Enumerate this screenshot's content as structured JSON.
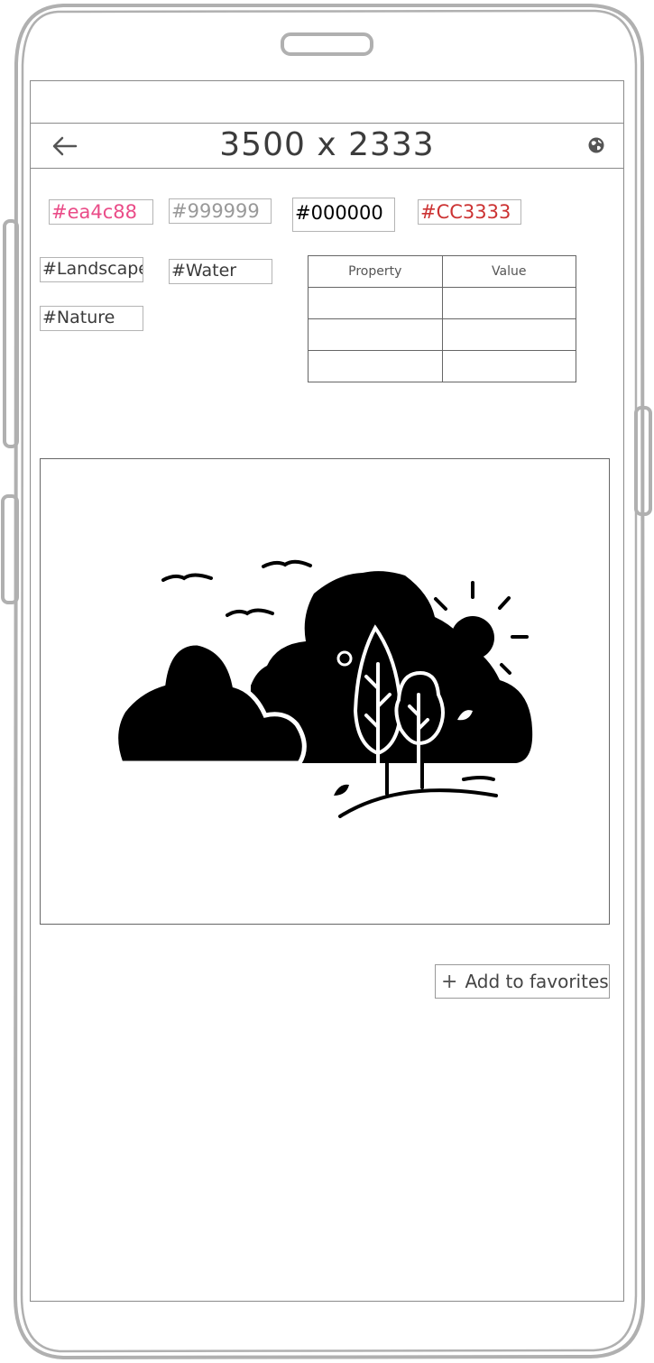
{
  "header": {
    "title": "3500 x 2333",
    "back_icon": "arrow-left-icon",
    "globe_icon": "globe-icon"
  },
  "colors": [
    {
      "label": "#ea4c88",
      "color": "#ea4c88"
    },
    {
      "label": "#999999",
      "color": "#999999"
    },
    {
      "label": "#000000",
      "color": "#000000"
    },
    {
      "label": "#CC3333",
      "color": "#CC3333"
    }
  ],
  "tags": [
    "#Landscape",
    "#Water",
    "#Nature"
  ],
  "table": {
    "headers": [
      "Property",
      "Value"
    ],
    "rows": [
      [
        "",
        ""
      ],
      [
        "",
        ""
      ],
      [
        "",
        ""
      ]
    ]
  },
  "image": {
    "icon": "landscape-icon"
  },
  "favorites": {
    "label": "Add to favorites",
    "icon": "plus-icon"
  }
}
